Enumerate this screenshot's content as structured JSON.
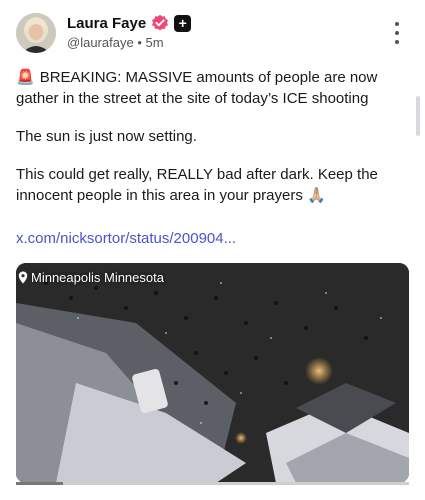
{
  "post": {
    "author_name": "Laura Faye",
    "handle": "@laurafaye",
    "separator": "•",
    "time": "5m",
    "siren_emoji": "🚨",
    "paragraph_1": "BREAKING: MASSIVE amounts of people are now gather in the street at the site of today’s ICE shooting",
    "paragraph_2": "The sun is just now setting.",
    "paragraph_3": "This could get really, REALLY bad after dark. Keep the innocent people in this area in your prayers",
    "prayer_emoji": "🙏🏼",
    "link_text": "x.com/nicksortor/status/200904...",
    "plus_label": "+"
  },
  "media": {
    "location_label": "Minneapolis Minnesota",
    "progress_fraction": 0.12
  },
  "icons": {
    "verified": "verified-badge-icon",
    "menu": "more-vertical-icon",
    "location": "location-pin-icon"
  },
  "colors": {
    "verified_badge": "#f0477a",
    "link": "#4a54c9",
    "siren": "#e0302e"
  }
}
